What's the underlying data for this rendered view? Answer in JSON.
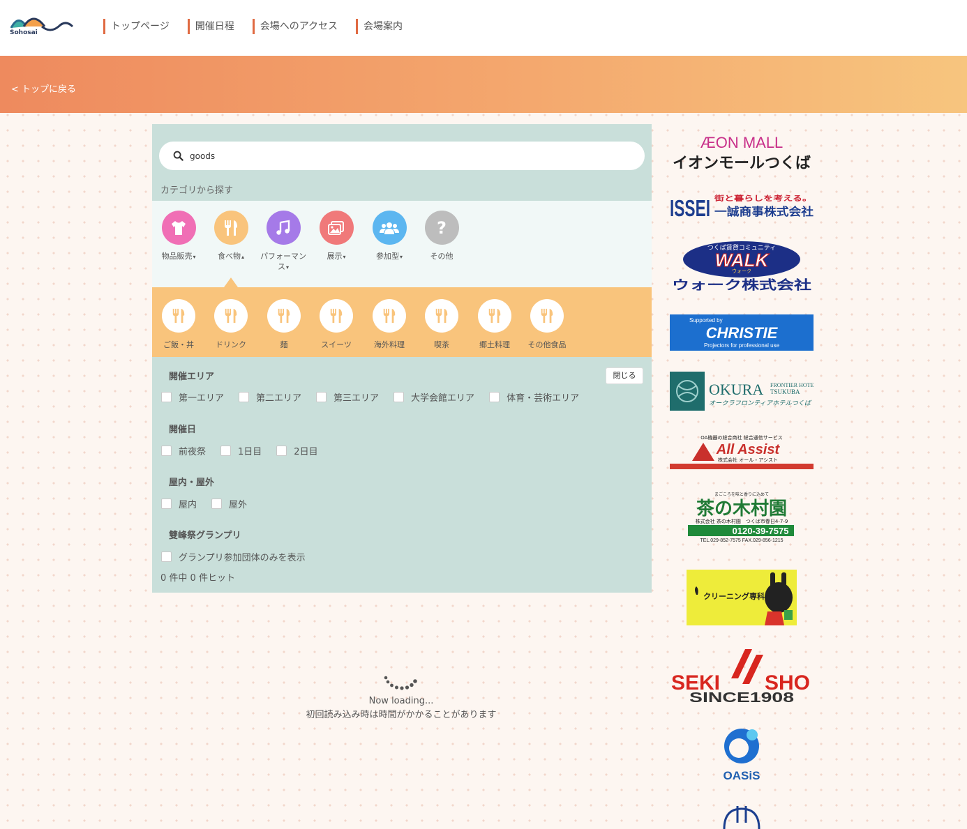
{
  "header": {
    "logo_text": "Sohosai",
    "nav": [
      "トップページ",
      "開催日程",
      "会場へのアクセス",
      "会場案内"
    ]
  },
  "banner": {
    "back_link": "< トップに戻る"
  },
  "search": {
    "value": "goods"
  },
  "categories": {
    "heading": "カテゴリから探す",
    "items": [
      {
        "label": "物品販売",
        "icon": "tshirt-icon",
        "color": "#f06fb5",
        "caret": "▾"
      },
      {
        "label": "食べ物",
        "icon": "fork-knife-icon",
        "color": "#f9c47c",
        "caret": "▴"
      },
      {
        "label": "パフォーマンス",
        "icon": "music-note-icon",
        "color": "#a57ae8",
        "caret": "▾"
      },
      {
        "label": "展示",
        "icon": "image-icon",
        "color": "#f0797a",
        "caret": "▾"
      },
      {
        "label": "参加型",
        "icon": "group-icon",
        "color": "#5cb6f0",
        "caret": "▾"
      },
      {
        "label": "その他",
        "icon": "question-icon",
        "color": "#bdbdbd",
        "caret": ""
      }
    ]
  },
  "subcategories": [
    "ご飯・丼",
    "ドリンク",
    "麺",
    "スイーツ",
    "海外料理",
    "喫茶",
    "郷土料理",
    "その他食品"
  ],
  "filters": {
    "close_label": "閉じる",
    "area": {
      "title": "開催エリア",
      "options": [
        "第一エリア",
        "第二エリア",
        "第三エリア",
        "大学会館エリア",
        "体育・芸術エリア"
      ]
    },
    "day": {
      "title": "開催日",
      "options": [
        "前夜祭",
        "1日目",
        "2日目"
      ]
    },
    "place": {
      "title": "屋内・屋外",
      "options": [
        "屋内",
        "屋外"
      ]
    },
    "grandprix": {
      "title": "雙峰祭グランプリ",
      "options": [
        "グランプリ参加団体のみを表示"
      ]
    },
    "hit_count": "0 件中 0 件ヒット"
  },
  "loading": {
    "line1": "Now loading...",
    "line2": "初回読み込み時は時間がかかることがあります"
  },
  "sponsors": {
    "aeon": {
      "line1": "ÆON MALL",
      "line2": "イオンモールつくば"
    },
    "issei": {
      "logo": "ISSEI",
      "tagline": "街と暮らしを考える。",
      "name": "一誠商事株式会社"
    },
    "walk": {
      "top": "つくば賃貸コミュニティ",
      "logo": "WALK",
      "kana": "ウォーク",
      "name": "ウォーク株式会社"
    },
    "christie": {
      "top": "Supported by",
      "logo": "CHRISTIE",
      "bottom": "Projectors for professional use"
    },
    "okura": {
      "logo": "OKURA",
      "side1": "FRONTIER HOTEL",
      "side2": "TSUKUBA",
      "jp": "オークラフロンティアホテルつくば"
    },
    "allassist": {
      "top": "OA機器の総合商社 総合通信サービス",
      "logo": "All Assist",
      "name": "株式会社 オール・アシスト"
    },
    "kimuraen": {
      "top": "まごころを味と香りに込めて",
      "logo": "茶の木村園",
      "address": "株式会社 茶の木村園　つくば市春日4-7-9",
      "tel": "0120-39-7575",
      "fax": "TEL.029-852-7575 FAX.029-856-1215"
    },
    "cleaning": {
      "text": "クリーニング専科"
    },
    "sekisho": {
      "logo_left": "SEKI",
      "logo_right": "SHO",
      "since": "SINCE1908"
    },
    "oasis": {
      "text": "OASiS"
    }
  }
}
